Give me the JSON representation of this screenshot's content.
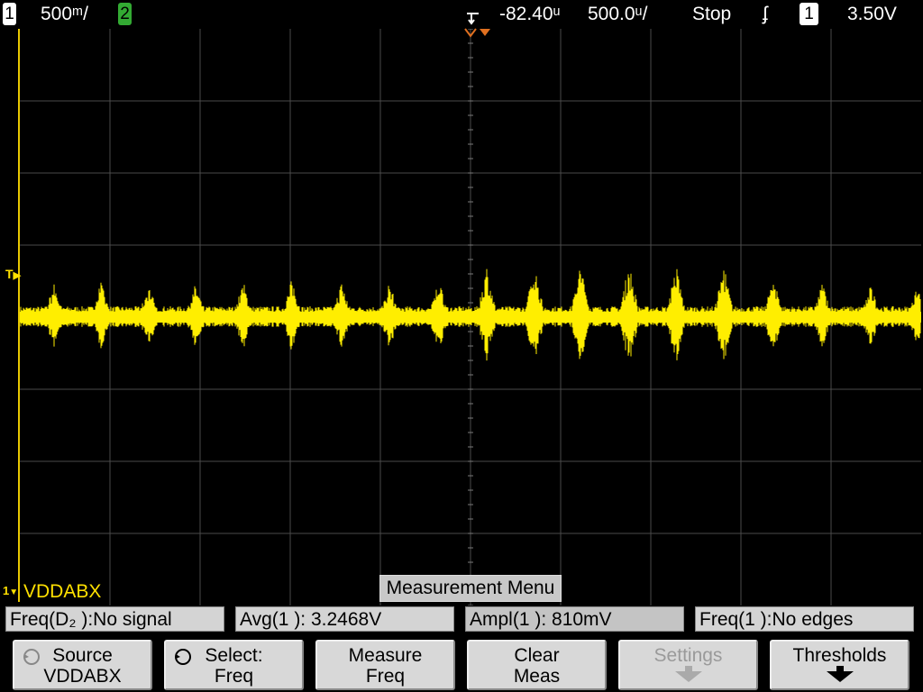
{
  "top_bar": {
    "ch1_number": "1",
    "ch1_scale": "500ᵐ/",
    "ch2_number": "2",
    "delay": "-82.40ᵘ",
    "timebase": "500.0ᵘ/",
    "run_state": "Stop",
    "trigger_slope_symbol": "ʄ",
    "trigger_channel": "1",
    "trigger_level": "3.50V"
  },
  "screen": {
    "channel_label": "VDDABX",
    "trigger_marker": "T",
    "ch1_marker": "1",
    "trace_color": "#ffee00"
  },
  "menu_title": "Measurement Menu",
  "measurements": [
    {
      "label": "Freq(D₂ ):No signal"
    },
    {
      "label": "Avg(1 ): 3.2468V"
    },
    {
      "label": "Ampl(1 ): 810mV"
    },
    {
      "label": "Freq(1 ):No edges"
    }
  ],
  "softkeys": [
    {
      "line1": "Source",
      "line2": "VDDABX",
      "icon": "rotate-knob-icon",
      "enabled": true
    },
    {
      "line1": "Select:",
      "line2": "Freq",
      "icon": "rotate-knob-icon",
      "enabled": true
    },
    {
      "line1": "Measure",
      "line2": "Freq",
      "enabled": true
    },
    {
      "line1": "Clear",
      "line2": "Meas",
      "enabled": true
    },
    {
      "line1": "Settings",
      "line2": "",
      "icon": "down-arrow-icon",
      "enabled": false
    },
    {
      "line1": "Thresholds",
      "line2": "",
      "icon": "down-arrow-icon",
      "enabled": true
    }
  ]
}
